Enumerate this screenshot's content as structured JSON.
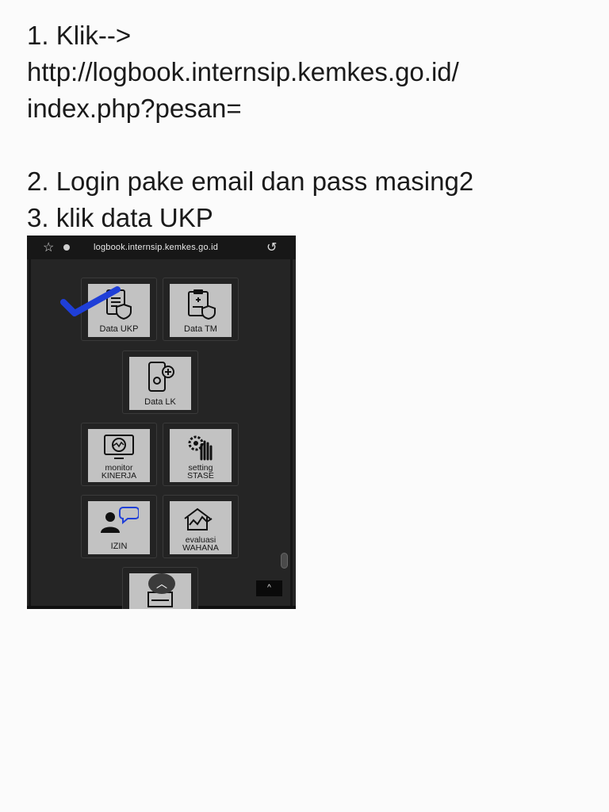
{
  "instructions": {
    "line1": "1. Klik-->",
    "line2": "http://logbook.internsip.kemkes.go.id/",
    "line3": "index.php?pesan=",
    "line4": "2. Login pake email dan pass masing2",
    "line5": "3. klik data UKP"
  },
  "screenshot": {
    "url": "logbook.internsip.kemkes.go.id",
    "tiles": {
      "data_ukp": "Data UKP",
      "data_tm": "Data TM",
      "data_lk": "Data LK",
      "monitor_line1": "monitor",
      "monitor_line2": "KINERJA",
      "setting_line1": "setting",
      "setting_line2": "STASE",
      "izin": "IZIN",
      "evaluasi_line1": "evaluasi",
      "evaluasi_line2": "WAHANA"
    },
    "top_button": "^",
    "icons": [
      "star-icon",
      "info-icon",
      "reload-icon",
      "document-shield-icon",
      "clipboard-shield-icon",
      "phone-plus-icon",
      "monitor-chart-icon",
      "gear-hand-icon",
      "person-chat-icon",
      "house-chart-icon",
      "chevron-up-icon",
      "checkmark-icon"
    ],
    "accent_check_color": "#1f3fd8"
  }
}
